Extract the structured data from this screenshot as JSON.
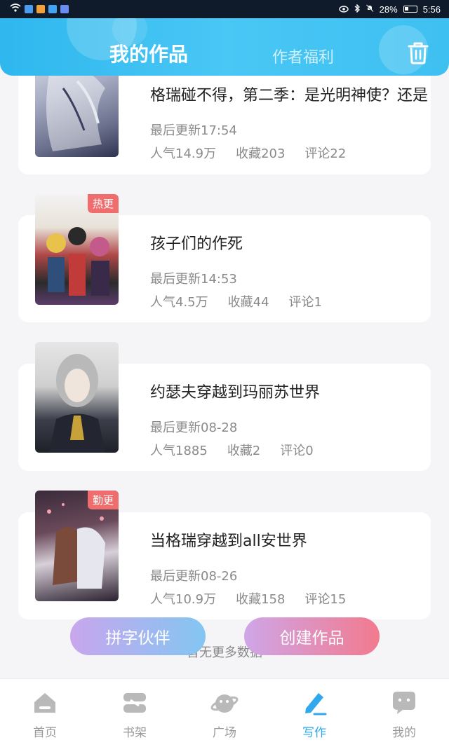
{
  "status_bar": {
    "battery": "28%",
    "time": "5:56"
  },
  "header": {
    "tab_mine": "我的作品",
    "tab_welfare": "作者福利"
  },
  "works": [
    {
      "title": "格瑞碰不得，第二季：是光明神使？还是",
      "update": "最后更新17:54",
      "popularity": "人气14.9万",
      "favorites": "收藏203",
      "comments": "评论22",
      "tag": ""
    },
    {
      "title": "孩子们的作死",
      "update": "最后更新14:53",
      "popularity": "人气4.5万",
      "favorites": "收藏44",
      "comments": "评论1",
      "tag": "热更"
    },
    {
      "title": "约瑟夫穿越到玛丽苏世界",
      "update": "最后更新08-28",
      "popularity": "人气1885",
      "favorites": "收藏2",
      "comments": "评论0",
      "tag": ""
    },
    {
      "title": "当格瑞穿越到all安世界",
      "update": "最后更新08-26",
      "popularity": "人气10.9万",
      "favorites": "收藏158",
      "comments": "评论15",
      "tag": "勤更"
    }
  ],
  "no_more": "暂无更多数据",
  "buttons": {
    "partner": "拼字伙伴",
    "create": "创建作品"
  },
  "nav": [
    {
      "label": "首页",
      "icon": "home-icon"
    },
    {
      "label": "书架",
      "icon": "bookshelf-icon"
    },
    {
      "label": "广场",
      "icon": "planet-icon"
    },
    {
      "label": "写作",
      "icon": "pen-icon"
    },
    {
      "label": "我的",
      "icon": "chat-face-icon"
    }
  ],
  "colors": {
    "accent": "#2fa8ee",
    "tag": "#f06d6d",
    "header": "#3ec0f1"
  }
}
